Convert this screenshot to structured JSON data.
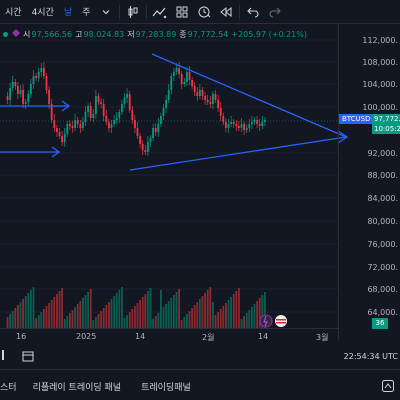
{
  "toolbar": {
    "items": [
      {
        "label": "시간",
        "active": false
      },
      {
        "label": "4시간",
        "active": false
      },
      {
        "label": "날",
        "active": true
      },
      {
        "label": "주",
        "active": false
      }
    ],
    "icons": [
      "chevron-down-icon",
      "candles-icon",
      "indicators-icon",
      "grid-layout-icon",
      "alert-icon",
      "replay-icon",
      "undo-icon",
      "redo-icon"
    ]
  },
  "ohlc": {
    "open_label": "시",
    "open_value": "97,566.56",
    "high_label": "고",
    "high_value": "98,024.83",
    "low_label": "저",
    "low_value": "97,283.89",
    "close_label": "종",
    "close_value": "97,772.54",
    "change": "+205.97 (+0.21%)"
  },
  "price_axis": {
    "ticks": [
      "112,000.",
      "108,000.",
      "104,000.",
      "100,000.",
      "92,000.",
      "88,000.",
      "84,000.",
      "80,000.",
      "76,000.",
      "72,000.",
      "68,000.",
      "64,000."
    ],
    "symbol_tag": "BTCUSD",
    "last_price": "97,772.",
    "countdown": "10:05:2",
    "badge": "36"
  },
  "time_axis": {
    "labels": [
      "16",
      "2025",
      "14",
      "2월",
      "14",
      "3월"
    ]
  },
  "bottom": {
    "clock": "22:54:34 UTC",
    "tabs": [
      "스터",
      "리플레이 트레이딩 패널",
      "트레이딩패널"
    ]
  },
  "colors": {
    "up": "#089981",
    "down": "#f23645",
    "accent": "#2962ff",
    "bg": "#131722"
  }
}
